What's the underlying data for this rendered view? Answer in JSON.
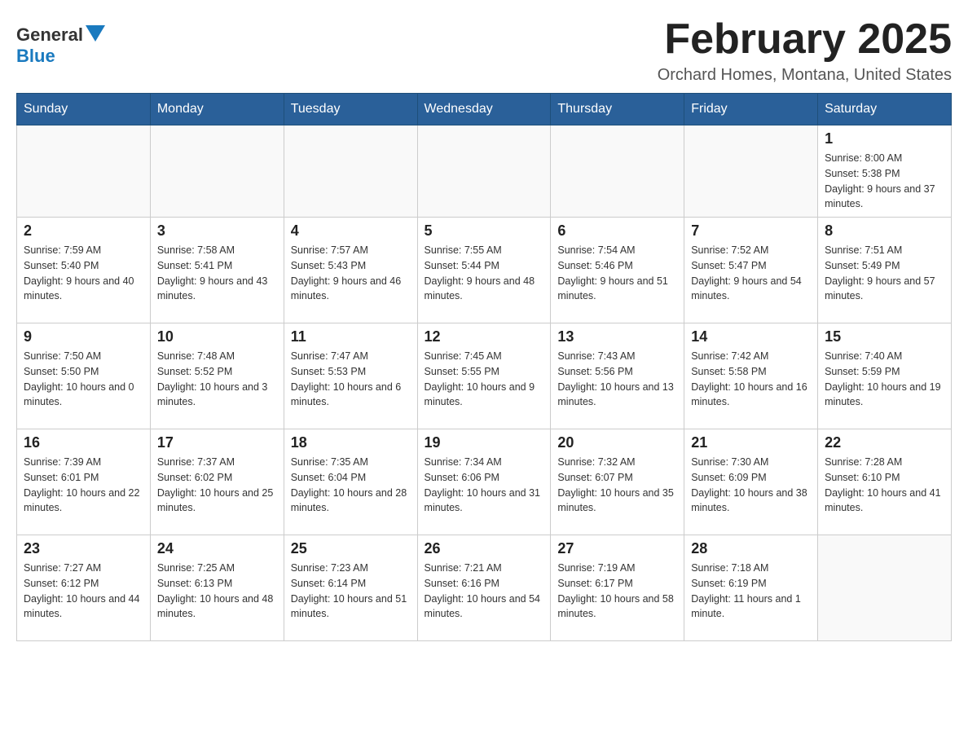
{
  "header": {
    "logo_general": "General",
    "logo_blue": "Blue",
    "month_title": "February 2025",
    "location": "Orchard Homes, Montana, United States"
  },
  "days_of_week": [
    "Sunday",
    "Monday",
    "Tuesday",
    "Wednesday",
    "Thursday",
    "Friday",
    "Saturday"
  ],
  "weeks": [
    [
      {
        "day": "",
        "info": ""
      },
      {
        "day": "",
        "info": ""
      },
      {
        "day": "",
        "info": ""
      },
      {
        "day": "",
        "info": ""
      },
      {
        "day": "",
        "info": ""
      },
      {
        "day": "",
        "info": ""
      },
      {
        "day": "1",
        "info": "Sunrise: 8:00 AM\nSunset: 5:38 PM\nDaylight: 9 hours and 37 minutes."
      }
    ],
    [
      {
        "day": "2",
        "info": "Sunrise: 7:59 AM\nSunset: 5:40 PM\nDaylight: 9 hours and 40 minutes."
      },
      {
        "day": "3",
        "info": "Sunrise: 7:58 AM\nSunset: 5:41 PM\nDaylight: 9 hours and 43 minutes."
      },
      {
        "day": "4",
        "info": "Sunrise: 7:57 AM\nSunset: 5:43 PM\nDaylight: 9 hours and 46 minutes."
      },
      {
        "day": "5",
        "info": "Sunrise: 7:55 AM\nSunset: 5:44 PM\nDaylight: 9 hours and 48 minutes."
      },
      {
        "day": "6",
        "info": "Sunrise: 7:54 AM\nSunset: 5:46 PM\nDaylight: 9 hours and 51 minutes."
      },
      {
        "day": "7",
        "info": "Sunrise: 7:52 AM\nSunset: 5:47 PM\nDaylight: 9 hours and 54 minutes."
      },
      {
        "day": "8",
        "info": "Sunrise: 7:51 AM\nSunset: 5:49 PM\nDaylight: 9 hours and 57 minutes."
      }
    ],
    [
      {
        "day": "9",
        "info": "Sunrise: 7:50 AM\nSunset: 5:50 PM\nDaylight: 10 hours and 0 minutes."
      },
      {
        "day": "10",
        "info": "Sunrise: 7:48 AM\nSunset: 5:52 PM\nDaylight: 10 hours and 3 minutes."
      },
      {
        "day": "11",
        "info": "Sunrise: 7:47 AM\nSunset: 5:53 PM\nDaylight: 10 hours and 6 minutes."
      },
      {
        "day": "12",
        "info": "Sunrise: 7:45 AM\nSunset: 5:55 PM\nDaylight: 10 hours and 9 minutes."
      },
      {
        "day": "13",
        "info": "Sunrise: 7:43 AM\nSunset: 5:56 PM\nDaylight: 10 hours and 13 minutes."
      },
      {
        "day": "14",
        "info": "Sunrise: 7:42 AM\nSunset: 5:58 PM\nDaylight: 10 hours and 16 minutes."
      },
      {
        "day": "15",
        "info": "Sunrise: 7:40 AM\nSunset: 5:59 PM\nDaylight: 10 hours and 19 minutes."
      }
    ],
    [
      {
        "day": "16",
        "info": "Sunrise: 7:39 AM\nSunset: 6:01 PM\nDaylight: 10 hours and 22 minutes."
      },
      {
        "day": "17",
        "info": "Sunrise: 7:37 AM\nSunset: 6:02 PM\nDaylight: 10 hours and 25 minutes."
      },
      {
        "day": "18",
        "info": "Sunrise: 7:35 AM\nSunset: 6:04 PM\nDaylight: 10 hours and 28 minutes."
      },
      {
        "day": "19",
        "info": "Sunrise: 7:34 AM\nSunset: 6:06 PM\nDaylight: 10 hours and 31 minutes."
      },
      {
        "day": "20",
        "info": "Sunrise: 7:32 AM\nSunset: 6:07 PM\nDaylight: 10 hours and 35 minutes."
      },
      {
        "day": "21",
        "info": "Sunrise: 7:30 AM\nSunset: 6:09 PM\nDaylight: 10 hours and 38 minutes."
      },
      {
        "day": "22",
        "info": "Sunrise: 7:28 AM\nSunset: 6:10 PM\nDaylight: 10 hours and 41 minutes."
      }
    ],
    [
      {
        "day": "23",
        "info": "Sunrise: 7:27 AM\nSunset: 6:12 PM\nDaylight: 10 hours and 44 minutes."
      },
      {
        "day": "24",
        "info": "Sunrise: 7:25 AM\nSunset: 6:13 PM\nDaylight: 10 hours and 48 minutes."
      },
      {
        "day": "25",
        "info": "Sunrise: 7:23 AM\nSunset: 6:14 PM\nDaylight: 10 hours and 51 minutes."
      },
      {
        "day": "26",
        "info": "Sunrise: 7:21 AM\nSunset: 6:16 PM\nDaylight: 10 hours and 54 minutes."
      },
      {
        "day": "27",
        "info": "Sunrise: 7:19 AM\nSunset: 6:17 PM\nDaylight: 10 hours and 58 minutes."
      },
      {
        "day": "28",
        "info": "Sunrise: 7:18 AM\nSunset: 6:19 PM\nDaylight: 11 hours and 1 minute."
      },
      {
        "day": "",
        "info": ""
      }
    ]
  ]
}
